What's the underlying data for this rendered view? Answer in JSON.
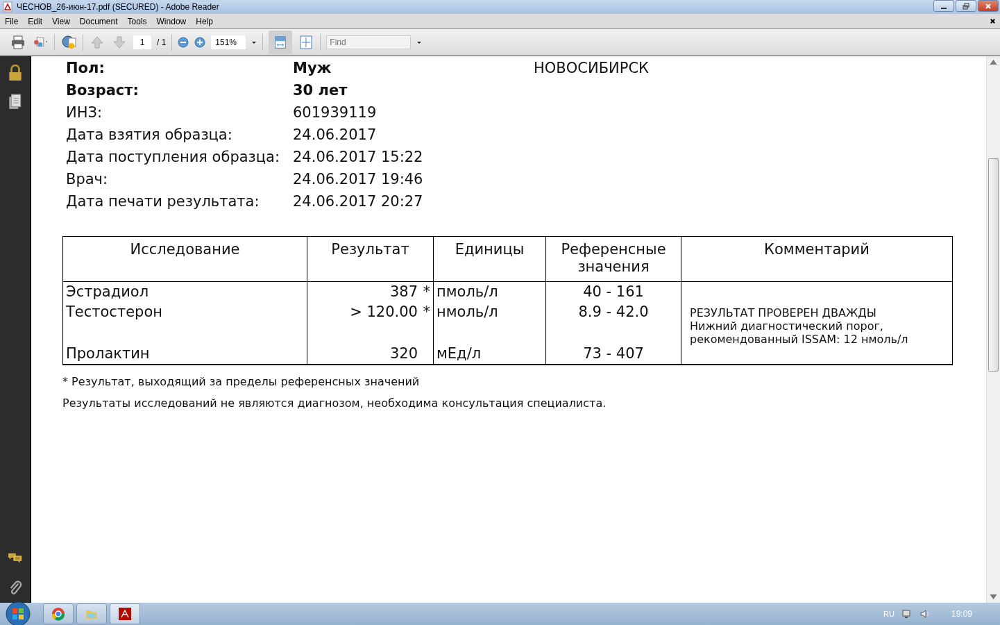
{
  "window": {
    "title": "ЧЕСНОВ_26-июн-17.pdf (SECURED) - Adobe Reader"
  },
  "menu": [
    "File",
    "Edit",
    "View",
    "Document",
    "Tools",
    "Window",
    "Help"
  ],
  "toolbar": {
    "page": "1",
    "page_total": "/ 1",
    "zoom": "151%",
    "find": {
      "placeholder": "Find"
    }
  },
  "document": {
    "city": "НОВОСИБИРСК",
    "info": [
      {
        "label": "Пол:",
        "value": "Муж",
        "bold": true
      },
      {
        "label": "Возраст:",
        "value": "30 лет",
        "bold": true
      },
      {
        "label": "ИНЗ:",
        "value": "601939119",
        "bold": false
      },
      {
        "label": "Дата взятия образца:",
        "value": "24.06.2017",
        "bold": false
      },
      {
        "label": "Дата поступления образца:",
        "value": "24.06.2017 15:22",
        "bold": false
      },
      {
        "label": "Врач:",
        "value": "24.06.2017 19:46",
        "bold": false
      },
      {
        "label": "Дата печати результата:",
        "value": "24.06.2017 20:27",
        "bold": false
      }
    ],
    "table": {
      "columns": [
        "Исследование",
        "Результат",
        "Единицы",
        "Референсные значения",
        "Комментарий"
      ],
      "rows": [
        {
          "test": "Эстрадиол",
          "result": "387",
          "flag": "*",
          "units": "пмоль/л",
          "reference": "40 - 161"
        },
        {
          "test": "Тестостерон",
          "result": "> 120.00",
          "flag": "*",
          "units": "нмоль/л",
          "reference": "8.9 - 42.0"
        },
        {
          "test": "Пролактин",
          "result": "320",
          "flag": "",
          "units": "мЕд/л",
          "reference": "73 - 407"
        }
      ],
      "comment": [
        "РЕЗУЛЬТАТ ПРОВЕРЕН ДВАЖДЫ",
        "Нижний диагностический порог,",
        "рекомендованный ISSAM: 12 нмоль/л"
      ]
    },
    "footnotes": [
      "* Результат, выходящий за пределы референсных значений",
      "Результаты исследований не являются диагнозом, необходима консультация специалиста."
    ]
  },
  "taskbar": {
    "language": "RU",
    "time": "19:09"
  }
}
